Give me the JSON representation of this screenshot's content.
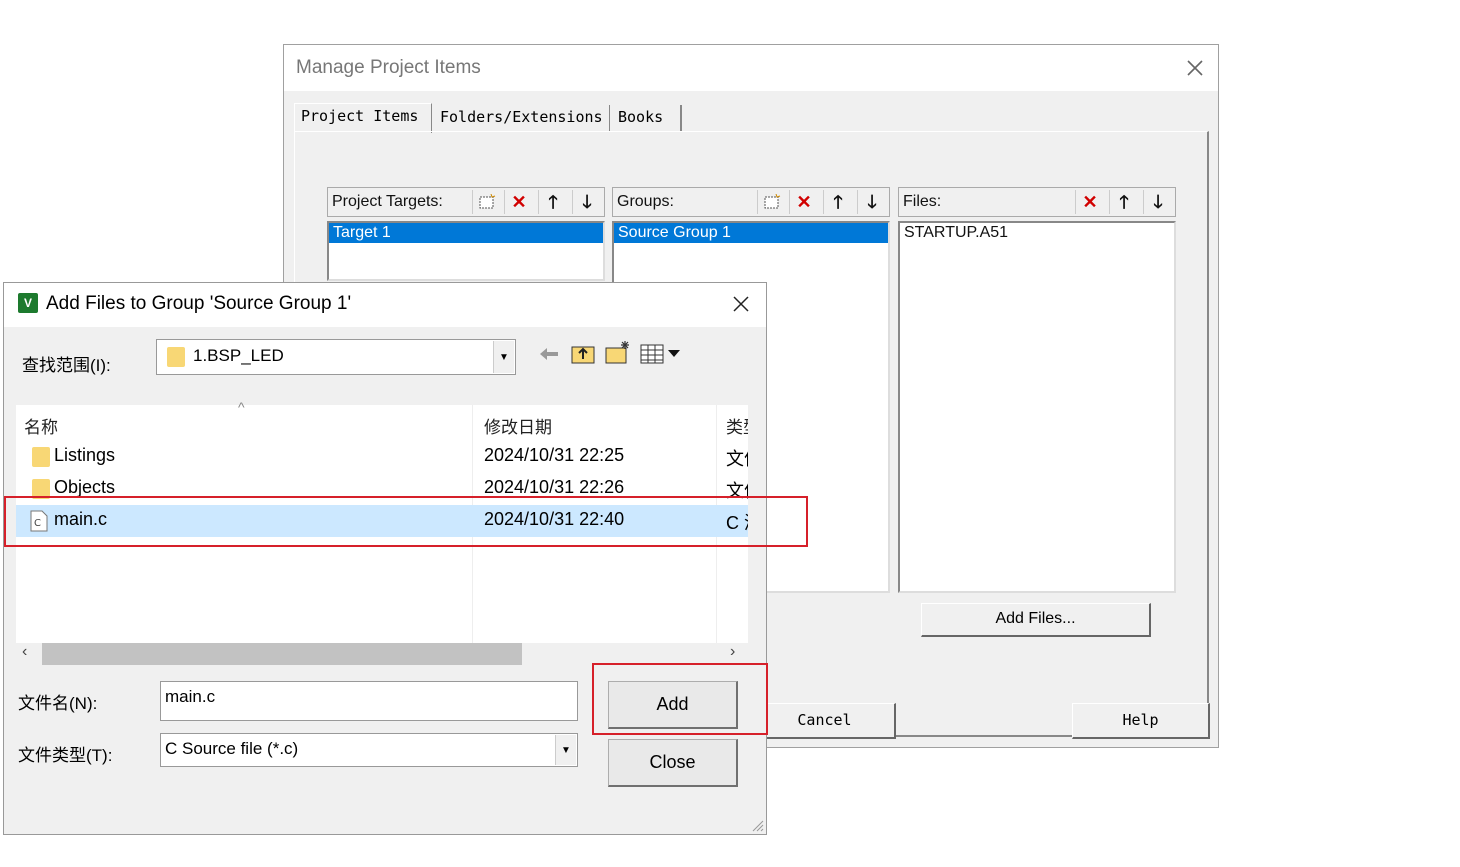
{
  "manage_dialog": {
    "title": "Manage Project Items",
    "tabs": [
      "Project Items",
      "Folders/Extensions",
      "Books"
    ],
    "targets": {
      "label": "Project Targets:",
      "items": [
        "Target 1"
      ]
    },
    "groups": {
      "label": "Groups:",
      "items": [
        "Source Group 1"
      ]
    },
    "files": {
      "label": "Files:",
      "items": [
        "STARTUP.A51"
      ]
    },
    "add_files_button": "Add Files...",
    "cancel_button": "Cancel",
    "help_button": "Help"
  },
  "add_dialog": {
    "title": "Add Files to Group 'Source Group 1'",
    "lookin_label": "查找范围(I):",
    "lookin_value": "1.BSP_LED",
    "columns": {
      "name": "名称",
      "date": "修改日期",
      "type": "类型"
    },
    "files": [
      {
        "name": "Listings",
        "date": "2024/10/31 22:25",
        "type": "文件夹",
        "icon": "folder-icon"
      },
      {
        "name": "Objects",
        "date": "2024/10/31 22:26",
        "type": "文件夹",
        "icon": "folder-icon"
      },
      {
        "name": "main.c",
        "date": "2024/10/31 22:40",
        "type": "C 源文件",
        "icon": "c-file-icon",
        "selected": true
      }
    ],
    "filename_label": "文件名(N):",
    "filename_value": "main.c",
    "filetype_label": "文件类型(T):",
    "filetype_value": "C Source file (*.c)",
    "add_button": "Add",
    "close_button": "Close"
  },
  "colors": {
    "highlight": "#d6202a",
    "selection": "#0078d7",
    "row_selected": "#cce8ff"
  }
}
